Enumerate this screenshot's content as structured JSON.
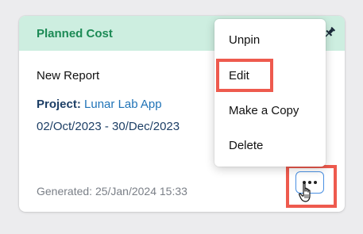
{
  "card": {
    "title": "Planned Cost",
    "report_name": "New Report",
    "project_label": "Project:",
    "project_value": "Lunar Lab App",
    "date_range": "02/Oct/2023 - 30/Dec/2023",
    "generated": "Generated: 25/Jan/2024 15:33",
    "pin_icon": "pin-icon",
    "more_icon": "ellipsis-icon"
  },
  "menu": {
    "items": [
      {
        "label": "Unpin"
      },
      {
        "label": "Edit"
      },
      {
        "label": "Make a Copy"
      },
      {
        "label": "Delete"
      }
    ]
  },
  "colors": {
    "header_bg": "#cdeee0",
    "title": "#1c8a55",
    "project_value": "#1f73b7",
    "highlight": "#ee5a4e",
    "button_border": "#4a90e2"
  }
}
